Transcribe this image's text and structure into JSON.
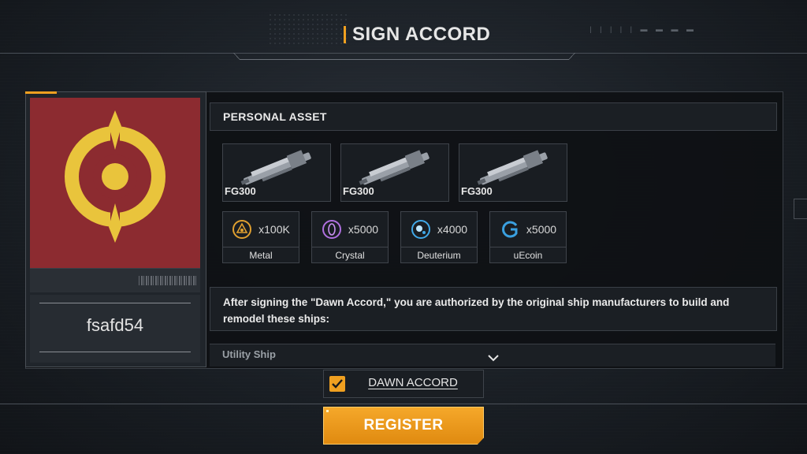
{
  "header": {
    "title": "SIGN ACCORD"
  },
  "profile": {
    "username": "fsafd54",
    "emblem": "accord-emblem-icon"
  },
  "assets": {
    "section_title": "PERSONAL ASSET",
    "ships": [
      {
        "label": "FG300",
        "icon": "ship-icon"
      },
      {
        "label": "FG300",
        "icon": "ship-icon"
      },
      {
        "label": "FG300",
        "icon": "ship-icon"
      }
    ],
    "resources": [
      {
        "name": "Metal",
        "amount": "x100K",
        "icon": "metal-icon",
        "color": "#e0a030"
      },
      {
        "name": "Crystal",
        "amount": "x5000",
        "icon": "crystal-icon",
        "color": "#b070e0"
      },
      {
        "name": "Deuterium",
        "amount": "x4000",
        "icon": "deuterium-icon",
        "color": "#40a8e8"
      },
      {
        "name": "uEcoin",
        "amount": "x5000",
        "icon": "uecoin-icon",
        "color": "#3aa0e0"
      }
    ]
  },
  "description": "After signing the \"Dawn Accord,\" you are authorized by the original ship manufacturers to build and remodel these ships:",
  "list_next": "Utility Ship",
  "accord": {
    "label": "DAWN ACCORD",
    "checked": true
  },
  "register": {
    "label": "REGISTER"
  },
  "colors": {
    "accent": "#f0a020",
    "emblem_bg": "#8c2b30",
    "emblem_fg": "#e9c43c"
  }
}
